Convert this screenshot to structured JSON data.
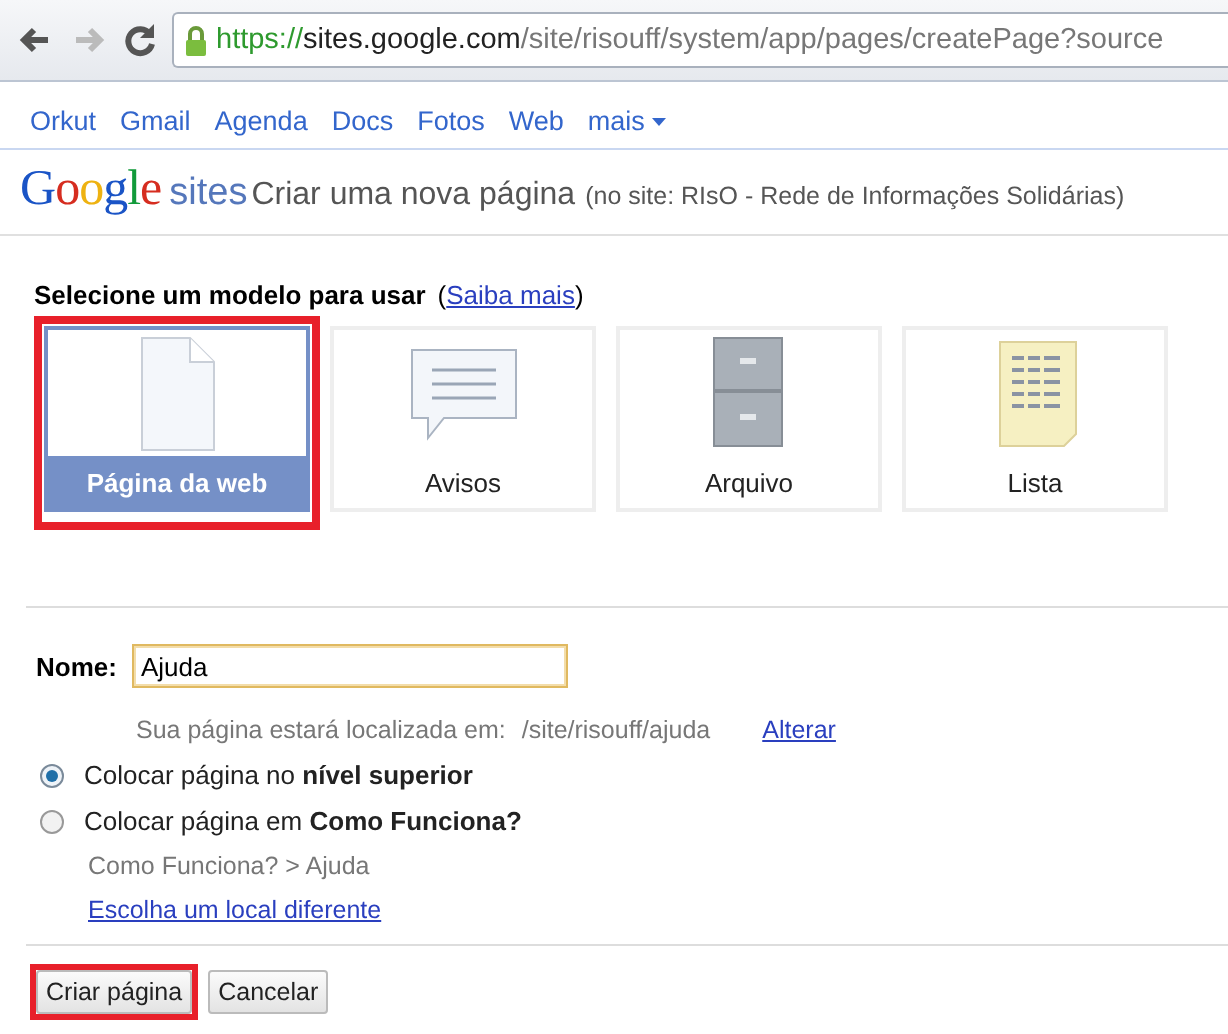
{
  "browser": {
    "url": {
      "scheme": "https://",
      "host": "sites.google.com",
      "path": "/site/risouff/system/app/pages/createPage?source"
    }
  },
  "nav": [
    {
      "label": "Orkut"
    },
    {
      "label": "Gmail"
    },
    {
      "label": "Agenda"
    },
    {
      "label": "Docs"
    },
    {
      "label": "Fotos"
    },
    {
      "label": "Web"
    },
    {
      "label": "mais",
      "kind": "menu"
    }
  ],
  "header": {
    "logo": "Google",
    "product": "sites",
    "title": "Criar uma nova página",
    "subtitle": "(no site: RIsO - Rede de Informações Solidárias)"
  },
  "template_prompt": {
    "label": "Selecione um modelo para usar",
    "link_open": "(",
    "link": "Saiba mais",
    "link_close": ")"
  },
  "templates": [
    {
      "label": "Página da web",
      "kind": "page",
      "selected": true,
      "highlighted": true
    },
    {
      "label": "Avisos",
      "kind": "announcements",
      "selected": false,
      "highlighted": false
    },
    {
      "label": "Arquivo",
      "kind": "cabinet",
      "selected": false,
      "highlighted": false
    },
    {
      "label": "Lista",
      "kind": "list",
      "selected": false,
      "highlighted": false
    }
  ],
  "name_field": {
    "label": "Nome:",
    "value": "Ajuda"
  },
  "location": {
    "label": "Sua página estará localizada em:",
    "path": "/site/risouff/ajuda",
    "link": "Alterar"
  },
  "placement": [
    {
      "label": "Colocar página no **nível superior**",
      "selected": true
    },
    {
      "label": "Colocar página em **Como Funciona?**",
      "selected": false
    }
  ],
  "breadcrumb": "Como Funciona? > Ajuda",
  "choose_link": "Escolha um local diferente",
  "buttons": [
    {
      "label": "Criar página",
      "highlighted": true
    },
    {
      "label": "Cancelar",
      "highlighted": false
    }
  ]
}
